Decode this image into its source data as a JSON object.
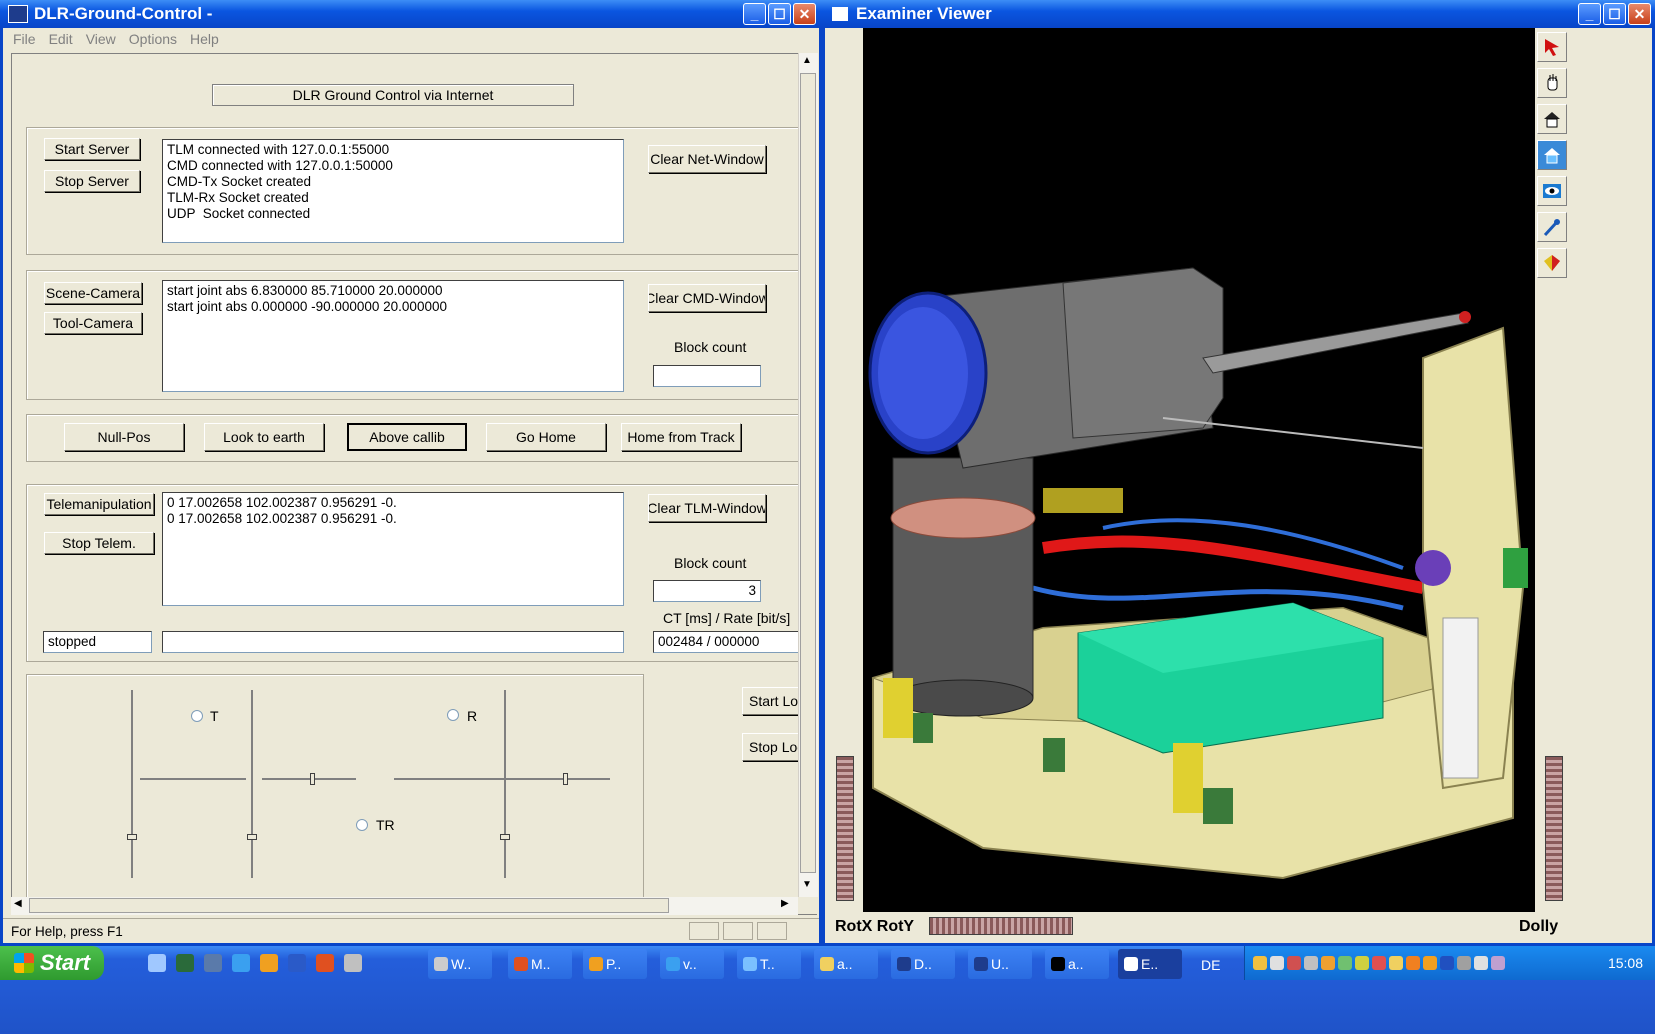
{
  "left_window": {
    "title": "DLR-Ground-Control -",
    "menu": [
      "File",
      "Edit",
      "View",
      "Options",
      "Help"
    ],
    "header": "DLR Ground Control via Internet",
    "net": {
      "start_label": "Start Server",
      "stop_label": "Stop Server",
      "log": "TLM connected with 127.0.0.1:55000\nCMD connected with 127.0.0.1:50000\nCMD-Tx Socket created\nTLM-Rx Socket created\nUDP  Socket connected",
      "clear_label": "Clear Net-Window"
    },
    "cmd": {
      "scene_label": "Scene-Camera",
      "tool_label": "Tool-Camera",
      "log": "start joint abs 6.830000 85.710000 20.000000\nstart joint abs 0.000000 -90.000000 20.000000",
      "clear_label": "Clear CMD-Window",
      "block_label": "Block count",
      "block_value": ""
    },
    "presets": [
      "Null-Pos",
      "Look to earth",
      "Above callib",
      "Go Home",
      "Home from Track"
    ],
    "tlm": {
      "telemanip_label": "Telemanipulation",
      "stop_label": "Stop Telem.",
      "log": "0 17.002658 102.002387 0.956291 -0.\n0 17.002658 102.002387 0.956291 -0.",
      "clear_label": "Clear TLM-Window",
      "block_label": "Block count",
      "block_value": "3",
      "ct_label": "CT [ms] /  Rate [bit/s]",
      "status_value": "stopped",
      "message_value": "",
      "ct_value": "002484 / 000000"
    },
    "control": {
      "radio_t": "T",
      "radio_r": "R",
      "radio_tr": "TR",
      "start_log": "Start Log",
      "stop_log": "Stop Log"
    },
    "statusbar": "For Help, press F1"
  },
  "right_window": {
    "title": "Examiner Viewer",
    "rot_label": "RotX RotY",
    "dolly_label": "Dolly",
    "tools": [
      "pointer-icon",
      "hand-icon",
      "home-icon",
      "set-home-icon",
      "view-all-icon",
      "seek-icon",
      "projection-icon"
    ]
  },
  "taskbar": {
    "start_label": "Start",
    "tasks": [
      "W..",
      "M..",
      "P..",
      "v..",
      "T..",
      "a..",
      "D..",
      "U..",
      "a..",
      "E.."
    ],
    "language": "DE",
    "clock": "15:08"
  }
}
